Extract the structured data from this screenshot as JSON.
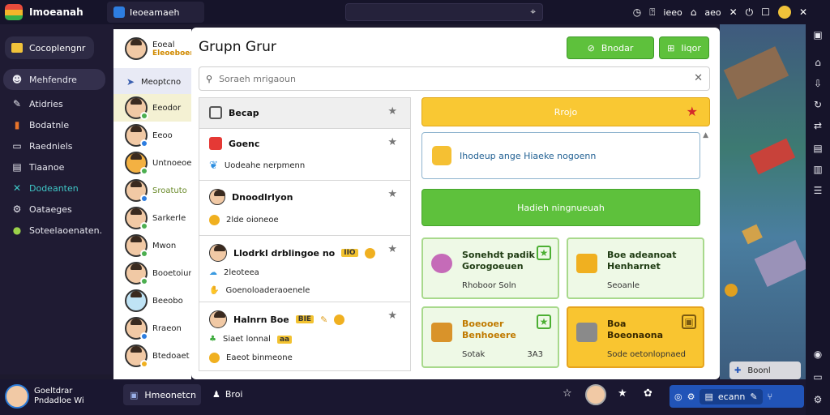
{
  "topbar": {
    "app_title": "Imoeanah",
    "tab_label": "Ieoeamaeh",
    "address_icon": "cursor-icon",
    "right_labels": [
      "ieeo",
      "aeo"
    ]
  },
  "sidebar": {
    "campaign_label": "Cocoplengnr",
    "items": [
      {
        "label": "Mehfendre",
        "icon": "avatar-icon",
        "active": true
      },
      {
        "label": "Atidries",
        "icon": "pen-icon"
      },
      {
        "label": "Bodatnle",
        "icon": "book-icon"
      },
      {
        "label": "Raedniels",
        "icon": "envelope-icon"
      },
      {
        "label": "Tiaanoe",
        "icon": "chat-icon"
      },
      {
        "label": "Dodeanten",
        "icon": "tools-icon",
        "accent": "#3fc7c7"
      },
      {
        "label": "Oataeges",
        "icon": "settings-icon"
      },
      {
        "label": "Soteelaoenaten.",
        "icon": "globe-icon"
      }
    ]
  },
  "contacts": {
    "items": [
      {
        "name": "Eoeal",
        "sub": "Eleoeboen"
      },
      {
        "name": "Meoptcno",
        "sub": ""
      },
      {
        "name": "Eeodor",
        "sub": ""
      },
      {
        "name": "Eeoo",
        "sub": ""
      },
      {
        "name": "Untnoeoe",
        "sub": ""
      },
      {
        "name": "Sroatuto",
        "sub": ""
      },
      {
        "name": "Sarkerle",
        "sub": ""
      },
      {
        "name": "Mwon",
        "sub": ""
      },
      {
        "name": "Booetoiur",
        "sub": ""
      },
      {
        "name": "Beeobo",
        "sub": ""
      },
      {
        "name": "Rraeon",
        "sub": ""
      },
      {
        "name": "Btedoaet",
        "sub": ""
      }
    ]
  },
  "panel": {
    "title": "Grupn Grur",
    "btn_primary": "Bnodar",
    "btn_secondary": "Iiqor",
    "search_placeholder": "Soraeh mrigaoun"
  },
  "list": {
    "rows": [
      {
        "title": "Becap",
        "lines": []
      },
      {
        "title": "Goenc",
        "lines": [
          "Uodeahe nerpmenn"
        ]
      },
      {
        "title": "Dnoodlrlyon",
        "lines": [
          "2lde oioneoe"
        ]
      },
      {
        "title": "Llodrkl drblingoe no",
        "badge": "IIO",
        "lines": [
          "2leoteea",
          "Goenoloaderaoenele"
        ]
      },
      {
        "title": "Halnrn Boe",
        "badge": "BIE",
        "lines": [
          "Siaet lonnal",
          "Eaeot binmeone"
        ],
        "sub_badge": "aa"
      }
    ]
  },
  "right": {
    "yellow_bar": "Rrojo",
    "info_text": "Ihodeup ange Hiaeke nogoenn",
    "green_bar": "Hadieh ningnueuah",
    "cards": [
      {
        "title": [
          "Sonehdt padik",
          "Gorogoeuen"
        ],
        "foot": "Rhoboor Soln",
        "style": "green"
      },
      {
        "title": [
          "Boe adeanoat",
          "Henharnet"
        ],
        "foot": "Seoanle",
        "style": "green"
      },
      {
        "title": [
          "Boeooer",
          "Benhoeere"
        ],
        "foot": "Sotak",
        "foot_right": "3A3",
        "style": "green",
        "gold": true
      },
      {
        "title": [
          "Boa",
          "Boeonaona"
        ],
        "foot": "Sode oetonlopnaed",
        "style": "orange"
      }
    ]
  },
  "game": {
    "report_label": "Boonl"
  },
  "bottombar": {
    "user_name": "Goeltdrar",
    "user_sub": "Pndadloe Wi",
    "chip_label": "Hmeonetcn",
    "item_label": "Broi",
    "blue_label": "ecann"
  }
}
